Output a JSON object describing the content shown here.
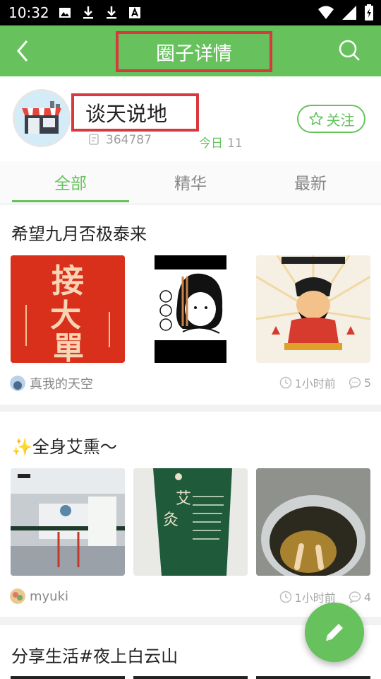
{
  "status_bar": {
    "time": "10:32"
  },
  "app_bar": {
    "title": "圈子详情"
  },
  "circle": {
    "name": "谈天说地",
    "member_count": "364787",
    "today_label": "今日",
    "today_count": "11",
    "follow_label": "关注"
  },
  "tabs": [
    {
      "label": "全部",
      "active": true
    },
    {
      "label": "精华",
      "active": false
    },
    {
      "label": "最新",
      "active": false
    }
  ],
  "posts": [
    {
      "title": "希望九月否极泰来",
      "author": "真我的天空",
      "time": "1小时前",
      "comments": "5",
      "images": [
        "poster-jie-da-dan",
        "cartoon-girl-incense",
        "god-of-wealth"
      ]
    },
    {
      "title": "✨全身艾熏～",
      "author": "myuki",
      "time": "1小时前",
      "comments": "4",
      "images": [
        "clinic-lobby",
        "moxibustion-sign",
        "herbal-basin"
      ]
    },
    {
      "title": "分享生活#夜上白云山",
      "author": "",
      "time": "",
      "comments": "",
      "images": []
    }
  ],
  "colors": {
    "accent": "#67c25e",
    "highlight_border": "#d8383e"
  }
}
